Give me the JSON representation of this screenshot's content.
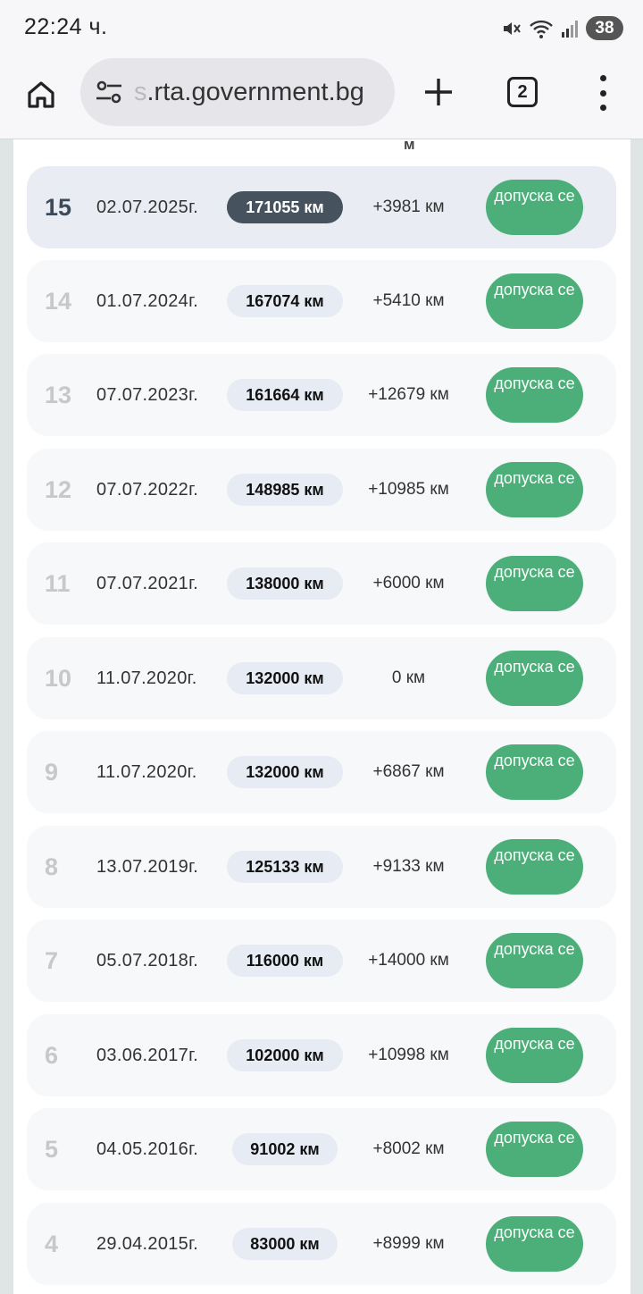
{
  "status_bar": {
    "time": "22:24 ч.",
    "battery": "38",
    "icons": [
      "mute-icon",
      "wifi-icon",
      "signal-icon",
      "battery-icon"
    ]
  },
  "browser": {
    "url_faded": "s",
    "url": ".rta.government.bg",
    "tab_count": "2"
  },
  "table": {
    "partial_header": "м",
    "rows": [
      {
        "num": "15",
        "date": "02.07.2025г.",
        "km": "171055 км",
        "diff": "+3981 км",
        "status": "допуска се",
        "active": true
      },
      {
        "num": "14",
        "date": "01.07.2024г.",
        "km": "167074 км",
        "diff": "+5410 км",
        "status": "допуска се"
      },
      {
        "num": "13",
        "date": "07.07.2023г.",
        "km": "161664 км",
        "diff": "+12679 км",
        "status": "допуска се"
      },
      {
        "num": "12",
        "date": "07.07.2022г.",
        "km": "148985 км",
        "diff": "+10985 км",
        "status": "допуска се"
      },
      {
        "num": "11",
        "date": "07.07.2021г.",
        "km": "138000 км",
        "diff": "+6000 км",
        "status": "допуска се"
      },
      {
        "num": "10",
        "date": "11.07.2020г.",
        "km": "132000 км",
        "diff": "0 км",
        "status": "допуска се"
      },
      {
        "num": "9",
        "date": "11.07.2020г.",
        "km": "132000 км",
        "diff": "+6867 км",
        "status": "допуска се"
      },
      {
        "num": "8",
        "date": "13.07.2019г.",
        "km": "125133 км",
        "diff": "+9133 км",
        "status": "допуска се"
      },
      {
        "num": "7",
        "date": "05.07.2018г.",
        "km": "116000 км",
        "diff": "+14000 км",
        "status": "допуска се"
      },
      {
        "num": "6",
        "date": "03.06.2017г.",
        "km": "102000 км",
        "diff": "+10998 км",
        "status": "допуска се"
      },
      {
        "num": "5",
        "date": "04.05.2016г.",
        "km": "91002 км",
        "diff": "+8002 км",
        "status": "допуска се"
      },
      {
        "num": "4",
        "date": "29.04.2015г.",
        "km": "83000 км",
        "diff": "+8999 км",
        "status": "допуска се"
      }
    ]
  }
}
